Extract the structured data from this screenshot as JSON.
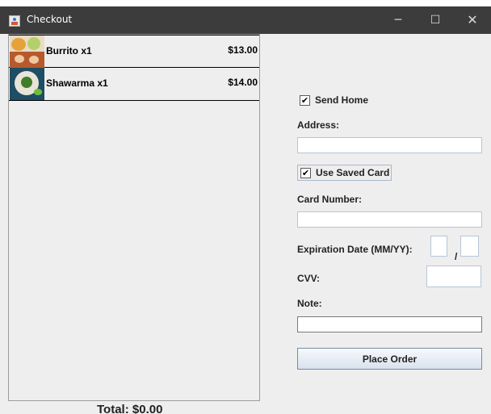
{
  "window": {
    "title": "Checkout",
    "minimize_glyph": "─",
    "maximize_glyph": "☐",
    "close_glyph": "✕"
  },
  "order": {
    "items": [
      {
        "name": "Burrito x1",
        "price": "$13.00",
        "image": "burrito-image"
      },
      {
        "name": "Shawarma x1",
        "price": "$14.00",
        "image": "shawarma-image"
      }
    ],
    "total": "Total: $0.00"
  },
  "form": {
    "send_home": {
      "label": "Send Home",
      "checked": true,
      "mark": "✔"
    },
    "address_label": "Address:",
    "address_value": "",
    "use_saved_card": {
      "label": "Use Saved Card",
      "checked": true,
      "mark": "✔"
    },
    "card_number_label": "Card Number:",
    "card_number_value": "",
    "expiration_label": "Expiration Date (MM/YY):",
    "exp_month_value": "",
    "exp_separator": "/",
    "exp_year_value": "",
    "cvv_label": "CVV:",
    "cvv_value": "",
    "note_label": "Note:",
    "note_value": "",
    "place_order_label": "Place Order"
  }
}
